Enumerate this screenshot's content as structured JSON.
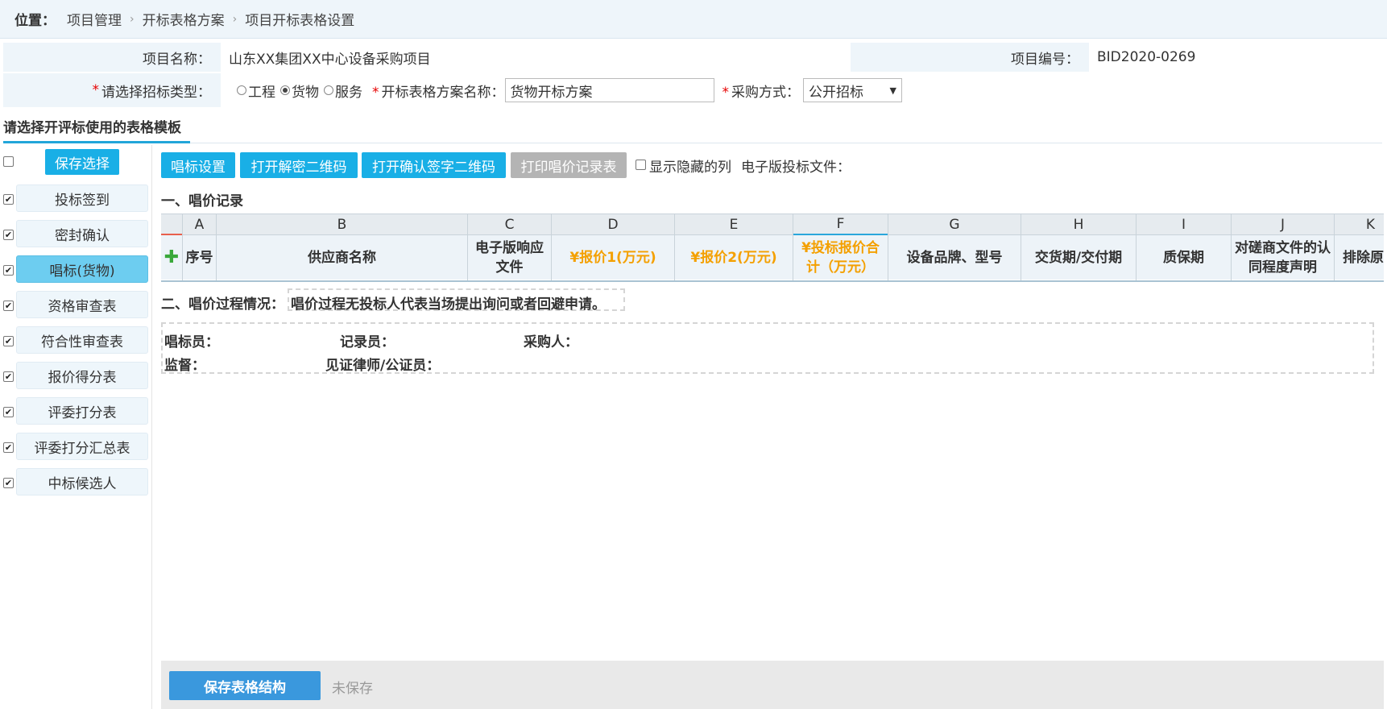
{
  "breadcrumb": {
    "label": "位置：",
    "items": [
      "项目管理",
      "开标表格方案",
      "项目开标表格设置"
    ]
  },
  "project": {
    "name_label": "项目名称：",
    "name_value": "山东XX集团XX中心设备采购项目",
    "code_label": "项目编号：",
    "code_value": "BID2020-0269"
  },
  "tender_type": {
    "label": "请选择招标类型：",
    "options": [
      "工程",
      "货物",
      "服务"
    ],
    "selected": "货物"
  },
  "scheme_name": {
    "label": "开标表格方案名称：",
    "value": "货物开标方案"
  },
  "purchase_method": {
    "label": "采购方式：",
    "value": "公开招标"
  },
  "section_title": "请选择开评标使用的表格模板",
  "sidebar": {
    "save_label": "保存选择",
    "items": [
      {
        "label": "投标签到",
        "checked": true
      },
      {
        "label": "密封确认",
        "checked": true
      },
      {
        "label": "唱标(货物)",
        "checked": true,
        "active": true
      },
      {
        "label": "资格审查表",
        "checked": true
      },
      {
        "label": "符合性审查表",
        "checked": true
      },
      {
        "label": "报价得分表",
        "checked": true
      },
      {
        "label": "评委打分表",
        "checked": true
      },
      {
        "label": "评委打分汇总表",
        "checked": true
      },
      {
        "label": "中标候选人",
        "checked": true
      }
    ]
  },
  "toolbar": {
    "buttons": [
      "唱标设置",
      "打开解密二维码",
      "打开确认签字二维码",
      "打印唱价记录表"
    ],
    "show_hidden_label": "显示隐藏的列",
    "efile_label": "电子版投标文件："
  },
  "record_title": "一、唱价记录",
  "grid": {
    "letters": [
      "A",
      "B",
      "C",
      "D",
      "E",
      "F",
      "G",
      "H",
      "I",
      "J",
      "K"
    ],
    "headers": [
      "序号",
      "供应商名称",
      "电子版响应文件",
      "¥报价1(万元)",
      "¥报价2(万元)",
      "¥投标报价合计（万元）",
      "设备品牌、型号",
      "交货期/交付期",
      "质保期",
      "对磋商文件的认同程度声明",
      "排除原"
    ]
  },
  "process": {
    "label": "二、唱价过程情况：",
    "text": "唱价过程无投标人代表当场提出询问或者回避申请。"
  },
  "signers": {
    "announcer": "唱标员：",
    "recorder": "记录员：",
    "purchaser": "采购人：",
    "supervisor": "监督：",
    "witness": "见证律师/公证员："
  },
  "footer": {
    "save_label": "保存表格结构",
    "status": "未保存"
  }
}
